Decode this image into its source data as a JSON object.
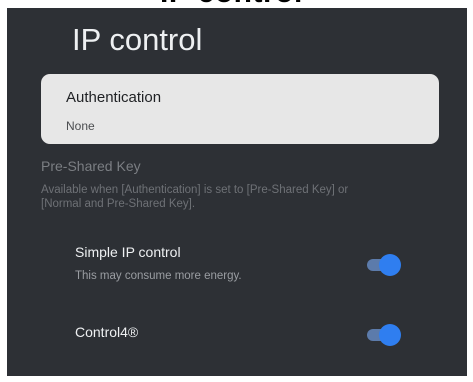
{
  "header": {
    "partial_heading": "IP control"
  },
  "page": {
    "title": "IP control"
  },
  "authentication": {
    "label": "Authentication",
    "value": "None"
  },
  "pre_shared_key": {
    "label": "Pre-Shared Key",
    "description": "Available when [Authentication] is set to [Pre-Shared Key] or [Normal and Pre-Shared Key]."
  },
  "simple_ip_control": {
    "label": "Simple IP control",
    "description": "This may consume more energy.",
    "enabled": true
  },
  "control4": {
    "label": "Control4®",
    "enabled": true
  },
  "colors": {
    "background": "#2d3035",
    "card": "#e7e7e7",
    "toggle_knob": "#2f7ef0",
    "toggle_track": "#5c7bab"
  }
}
